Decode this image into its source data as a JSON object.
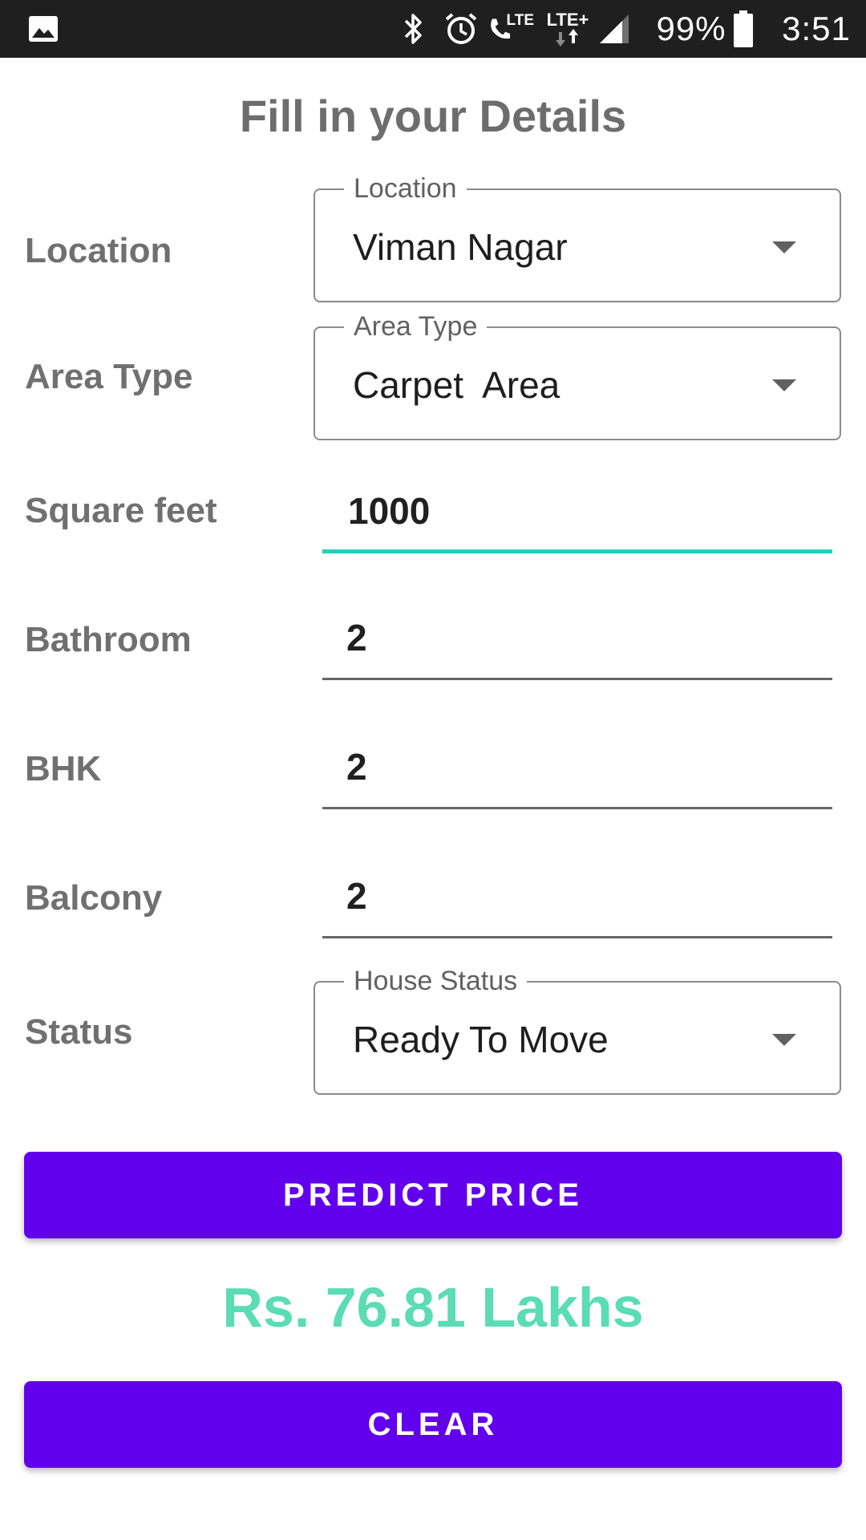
{
  "status_bar": {
    "battery_percent": "99%",
    "time": "3:51",
    "lte_label_1": "LTE",
    "lte_label_2": "LTE+",
    "icons": [
      "gallery-icon",
      "bluetooth-icon",
      "alarm-icon",
      "wifi-call-icon",
      "lte-plus-icon",
      "signal-icon",
      "battery-icon"
    ]
  },
  "title": "Fill in your Details",
  "form": {
    "location": {
      "label": "Location",
      "legend": "Location",
      "value": "Viman Nagar"
    },
    "area_type": {
      "label": "Area Type",
      "legend": "Area Type",
      "value": "Carpet  Area"
    },
    "square_feet": {
      "label": "Square feet",
      "value": "1000"
    },
    "bathroom": {
      "label": "Bathroom",
      "value": "2"
    },
    "bhk": {
      "label": "BHK",
      "value": "2"
    },
    "balcony": {
      "label": "Balcony",
      "value": "2"
    },
    "status": {
      "label": "Status",
      "legend": "House Status",
      "value": "Ready To Move"
    }
  },
  "predict_button": "PREDICT PRICE",
  "result": "Rs. 76.81 Lakhs",
  "clear_button": "CLEAR",
  "colors": {
    "accent": "#6200ee",
    "focus": "#20d1bd",
    "result": "#5bdcb3",
    "status_bar": "#1f1f1f"
  }
}
